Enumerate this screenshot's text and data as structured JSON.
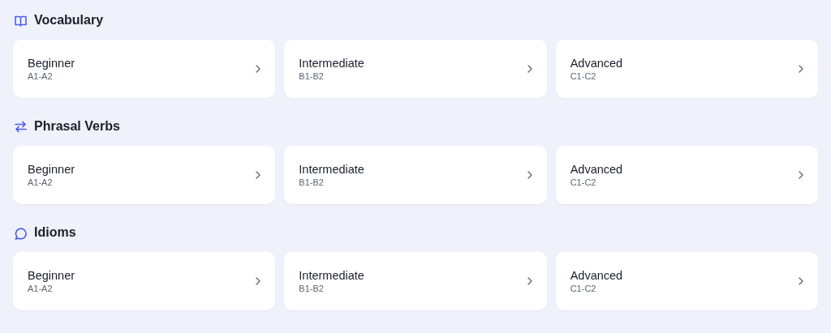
{
  "sections": [
    {
      "title": "Vocabulary",
      "levels": [
        {
          "name": "Beginner",
          "range": "A1-A2"
        },
        {
          "name": "Intermediate",
          "range": "B1-B2"
        },
        {
          "name": "Advanced",
          "range": "C1-C2"
        }
      ]
    },
    {
      "title": "Phrasal Verbs",
      "levels": [
        {
          "name": "Beginner",
          "range": "A1-A2"
        },
        {
          "name": "Intermediate",
          "range": "B1-B2"
        },
        {
          "name": "Advanced",
          "range": "C1-C2"
        }
      ]
    },
    {
      "title": "Idioms",
      "levels": [
        {
          "name": "Beginner",
          "range": "A1-A2"
        },
        {
          "name": "Intermediate",
          "range": "B1-B2"
        },
        {
          "name": "Advanced",
          "range": "C1-C2"
        }
      ]
    }
  ]
}
